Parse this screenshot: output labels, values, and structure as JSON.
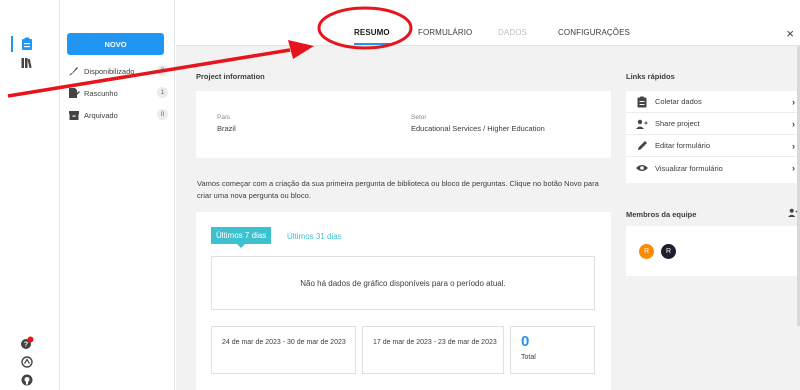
{
  "sidebar": {
    "new_button": "NOVO",
    "items": [
      {
        "label": "Disponibilizado",
        "count": "0"
      },
      {
        "label": "Rascunho",
        "count": "1"
      },
      {
        "label": "Arquivado",
        "count": "0"
      }
    ]
  },
  "tabs": [
    {
      "label": "RESUMO"
    },
    {
      "label": "FORMULÁRIO"
    },
    {
      "label": "DADOS"
    },
    {
      "label": "CONFIGURAÇÕES"
    }
  ],
  "close_label": "×",
  "project": {
    "section_title": "Project information",
    "country_label": "País",
    "country_value": "Brazil",
    "sector_label": "Setor",
    "sector_value": "Educational Services / Higher Education"
  },
  "intro_text": "Vamos começar com a criação da sua primeira pergunta de biblioteca ou bloco de perguntas. Clique no botão Novo para criar uma nova pergunta ou bloco.",
  "stats": {
    "tab_7": "Últimos 7 dias",
    "tab_31": "Últimos 31 dias",
    "no_data": "Não há dados de gráfico disponíveis para o período atual.",
    "range_current": "24 de mar de 2023 - 30 de mar de 2023",
    "range_previous": "17 de mar de 2023 - 23 de mar de 2023",
    "total_value": "0",
    "total_label": "Total"
  },
  "quick_links": {
    "title": "Links rápidos",
    "items": [
      {
        "label": "Coletar dados",
        "icon": "clipboard-icon"
      },
      {
        "label": "Share project",
        "icon": "add-person-icon"
      },
      {
        "label": "Editar formulário",
        "icon": "pencil-icon"
      },
      {
        "label": "Visualizar formulário",
        "icon": "eye-icon"
      }
    ]
  },
  "team": {
    "title": "Membros da equipe",
    "members": [
      {
        "initial": "R",
        "color": "#ff8a00"
      },
      {
        "initial": "R",
        "color": "#1e1e2e"
      }
    ]
  },
  "colors": {
    "accent": "#2095f2",
    "teal": "#3ec1cf",
    "annotation": "#e8141c",
    "badge": "#e8141c"
  }
}
